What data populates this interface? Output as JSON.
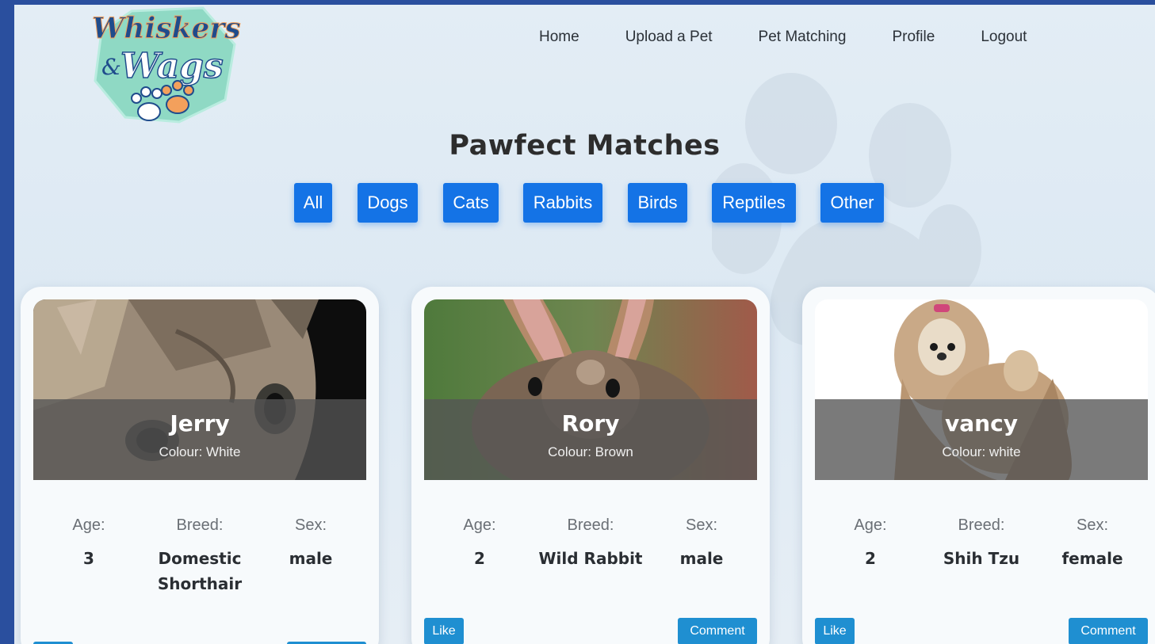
{
  "logo": {
    "line1": "Whiskers",
    "amp": "&",
    "line2": "Wags"
  },
  "nav": {
    "items": [
      "Home",
      "Upload a Pet",
      "Pet Matching",
      "Profile",
      "Logout"
    ]
  },
  "page": {
    "title": "Pawfect Matches"
  },
  "filters": [
    "All",
    "Dogs",
    "Cats",
    "Rabbits",
    "Birds",
    "Reptiles",
    "Other"
  ],
  "labels": {
    "age": "Age:",
    "breed": "Breed:",
    "sex": "Sex:",
    "like": "Like",
    "comment": "Comment"
  },
  "pets": [
    {
      "name": "Jerry",
      "colour": "Colour: White",
      "age": "3",
      "breed": "Domestic Shorthair",
      "sex": "male"
    },
    {
      "name": "Rory",
      "colour": "Colour: Brown",
      "age": "2",
      "breed": "Wild Rabbit",
      "sex": "male"
    },
    {
      "name": "vancy",
      "colour": "Colour: white",
      "age": "2",
      "breed": "Shih Tzu",
      "sex": "female"
    }
  ],
  "colors": {
    "accent": "#1473e6",
    "action": "#1f8fd1",
    "frame": "#2a4f9e"
  }
}
